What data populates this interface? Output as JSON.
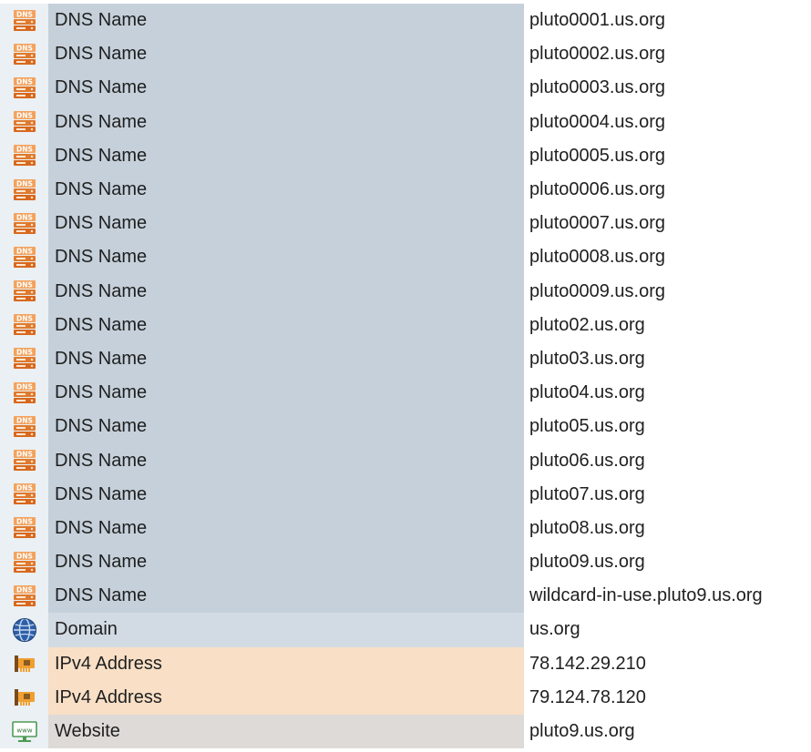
{
  "icons": {
    "dns": "dns-server-icon",
    "domain": "globe-icon",
    "ipv4": "network-card-icon",
    "website": "www-monitor-icon"
  },
  "colors": {
    "dns_band": "#c5d0da",
    "domain_band": "#d2dbe4",
    "ipv4_band": "#f8dfc6",
    "website_band": "#dedad8",
    "icon_column": "#eaf0f3",
    "dns_icon": "#e07a2e"
  },
  "dns_icon_text": "DNS",
  "website_icon_text": "www",
  "rows": [
    {
      "kind": "dns",
      "type": "DNS Name",
      "value": "pluto0001.us.org"
    },
    {
      "kind": "dns",
      "type": "DNS Name",
      "value": "pluto0002.us.org"
    },
    {
      "kind": "dns",
      "type": "DNS Name",
      "value": "pluto0003.us.org"
    },
    {
      "kind": "dns",
      "type": "DNS Name",
      "value": "pluto0004.us.org"
    },
    {
      "kind": "dns",
      "type": "DNS Name",
      "value": "pluto0005.us.org"
    },
    {
      "kind": "dns",
      "type": "DNS Name",
      "value": "pluto0006.us.org"
    },
    {
      "kind": "dns",
      "type": "DNS Name",
      "value": "pluto0007.us.org"
    },
    {
      "kind": "dns",
      "type": "DNS Name",
      "value": "pluto0008.us.org"
    },
    {
      "kind": "dns",
      "type": "DNS Name",
      "value": "pluto0009.us.org"
    },
    {
      "kind": "dns",
      "type": "DNS Name",
      "value": "pluto02.us.org"
    },
    {
      "kind": "dns",
      "type": "DNS Name",
      "value": "pluto03.us.org"
    },
    {
      "kind": "dns",
      "type": "DNS Name",
      "value": "pluto04.us.org"
    },
    {
      "kind": "dns",
      "type": "DNS Name",
      "value": "pluto05.us.org"
    },
    {
      "kind": "dns",
      "type": "DNS Name",
      "value": "pluto06.us.org"
    },
    {
      "kind": "dns",
      "type": "DNS Name",
      "value": "pluto07.us.org"
    },
    {
      "kind": "dns",
      "type": "DNS Name",
      "value": "pluto08.us.org"
    },
    {
      "kind": "dns",
      "type": "DNS Name",
      "value": "pluto09.us.org"
    },
    {
      "kind": "dns",
      "type": "DNS Name",
      "value": "wildcard-in-use.pluto9.us.org"
    },
    {
      "kind": "domain",
      "type": "Domain",
      "value": "us.org"
    },
    {
      "kind": "ipv4",
      "type": "IPv4 Address",
      "value": "78.142.29.210"
    },
    {
      "kind": "ipv4",
      "type": "IPv4 Address",
      "value": "79.124.78.120"
    },
    {
      "kind": "website",
      "type": "Website",
      "value": "pluto9.us.org"
    }
  ]
}
